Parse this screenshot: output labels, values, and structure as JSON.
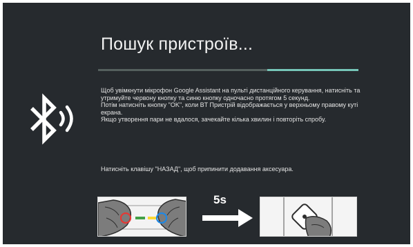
{
  "screen": {
    "title": "Пошук пристроїв...",
    "progress": 0.35,
    "instructions": [
      "Щоб увімкнути мікрофон Google Assistant на пульті дистанційного керування, натисніть та утримуйте червону кнопку та синю кнопку одночасно протягом 5 секунд.",
      "Потім натисніть кнопку \"OK\", коли BT Пристрій відображається у верхньому правому куті екрана.",
      "Якщо утворення пари не вдалося, зачекайте кілька хвилин і повторіть спробу."
    ],
    "back_note": "Натисніть клавішу \"НАЗАД\", щоб припинити додавання аксесуара.",
    "hold_duration": "5s"
  },
  "colors": {
    "background": "#262a2e",
    "progress_fill": "#76c6b8",
    "progress_track": "#55605e",
    "button_red": "#e53935",
    "button_green": "#43a047",
    "button_yellow": "#fdd835",
    "button_blue": "#1e88e5"
  },
  "icons": {
    "status": "bluetooth-searching-icon",
    "arrow": "arrow-right-icon"
  }
}
